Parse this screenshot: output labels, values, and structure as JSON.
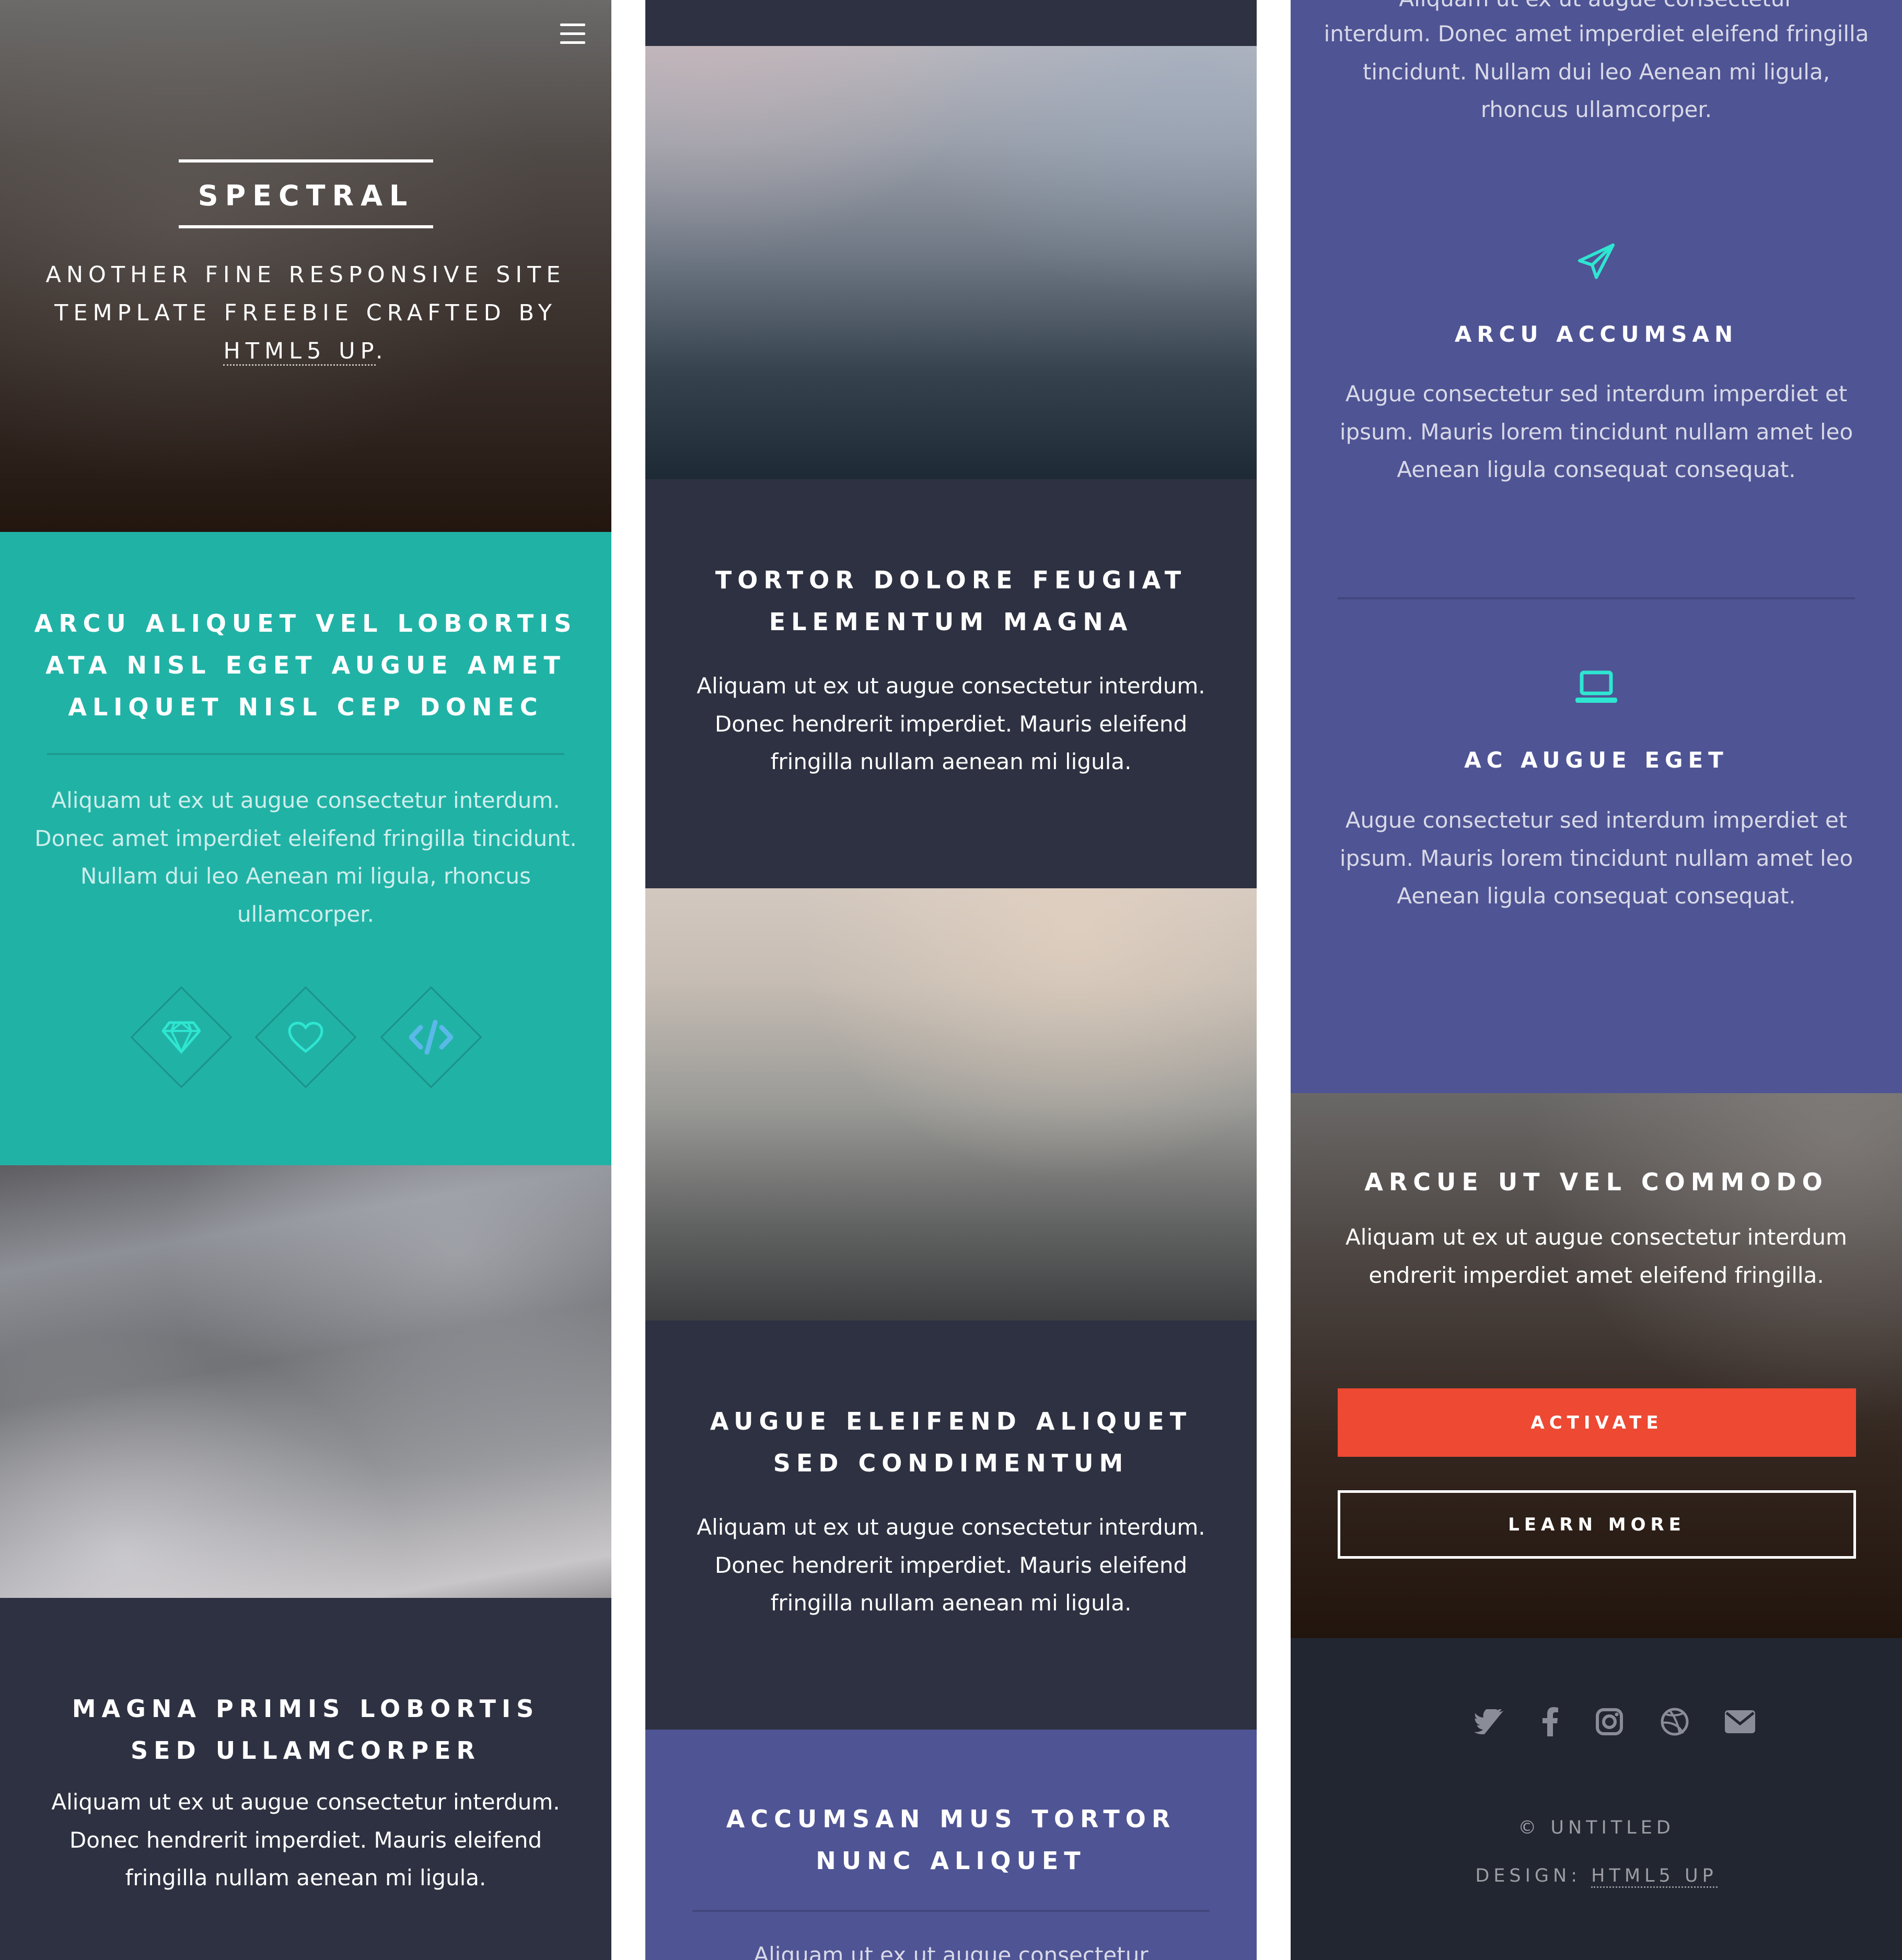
{
  "colors": {
    "teal": "#21b2a6",
    "dark": "#2e3141",
    "purple": "#4f5494",
    "accent": "#ed4933",
    "footer": "#222631",
    "icon_accent": "#2ee6d1"
  },
  "header": {
    "menu_icon": "hamburger-menu-icon",
    "logo": "SPECTRAL",
    "tagline_prefix": "ANOTHER FINE RESPONSIVE SITE TEMPLATE FREEBIE CRAFTED BY ",
    "tagline_link": "HTML5 UP",
    "tagline_suffix": "."
  },
  "banner": {
    "title_lines": [
      "ARCU ALIQUET VEL LOBORTIS",
      "ATA NISL EGET AUGUE AMET",
      "ALIQUET NISL CEP DONEC"
    ],
    "body": "Aliquam ut ex ut augue consectetur interdum. Donec amet imperdiet eleifend fringilla tincidunt. Nullam dui leo Aenean mi ligula, rhoncus ullamcorper.",
    "icons": [
      "diamond-icon",
      "heart-icon",
      "code-icon"
    ]
  },
  "spotlights": [
    {
      "title_lines": [
        "MAGNA PRIMIS LOBORTIS",
        "SED ULLAMCORPER"
      ],
      "body": "Aliquam ut ex ut augue consectetur interdum. Donec hendrerit imperdiet. Mauris eleifend fringilla nullam aenean mi ligula."
    },
    {
      "title_lines": [
        "TORTOR DOLORE FEUGIAT",
        "ELEMENTUM MAGNA"
      ],
      "body": "Aliquam ut ex ut augue consectetur interdum. Donec hendrerit imperdiet. Mauris eleifend fringilla nullam aenean mi ligula."
    },
    {
      "title_lines": [
        "AUGUE ELEIFEND ALIQUET",
        "SED CONDIMENTUM"
      ],
      "body": "Aliquam ut ex ut augue consectetur interdum. Donec hendrerit imperdiet. Mauris eleifend fringilla nullam aenean mi ligula."
    }
  ],
  "features": {
    "title_lines": [
      "ACCUMSAN MUS TORTOR",
      "NUNC ALIQUET"
    ],
    "intro_visible_top": "Aliquam ut ex ut augue consectetur",
    "intro_cont": "interdum. Donec amet imperdiet eleifend fringilla tincidunt. Nullam dui leo Aenean mi ligula, rhoncus ullamcorper.",
    "items": [
      {
        "icon": "paper-plane-icon",
        "title": "ARCU ACCUMSAN",
        "body": "Augue consectetur sed interdum imperdiet et ipsum. Mauris lorem tincidunt nullam amet leo Aenean ligula consequat consequat."
      },
      {
        "icon": "laptop-icon",
        "title": "AC AUGUE EGET",
        "body": "Augue consectetur sed interdum imperdiet et ipsum. Mauris lorem tincidunt nullam amet leo Aenean ligula consequat consequat."
      }
    ]
  },
  "cta": {
    "title": "ARCUE UT VEL COMMODO",
    "body": "Aliquam ut ex ut augue consectetur interdum endrerit imperdiet amet eleifend fringilla.",
    "activate_label": "ACTIVATE",
    "learn_more_label": "LEARN MORE"
  },
  "footer": {
    "social_icons": [
      "twitter-icon",
      "facebook-icon",
      "instagram-icon",
      "dribbble-icon",
      "email-icon"
    ],
    "copyright": "© UNTITLED",
    "design_prefix": "DESIGN: ",
    "design_link": "HTML5 UP"
  }
}
